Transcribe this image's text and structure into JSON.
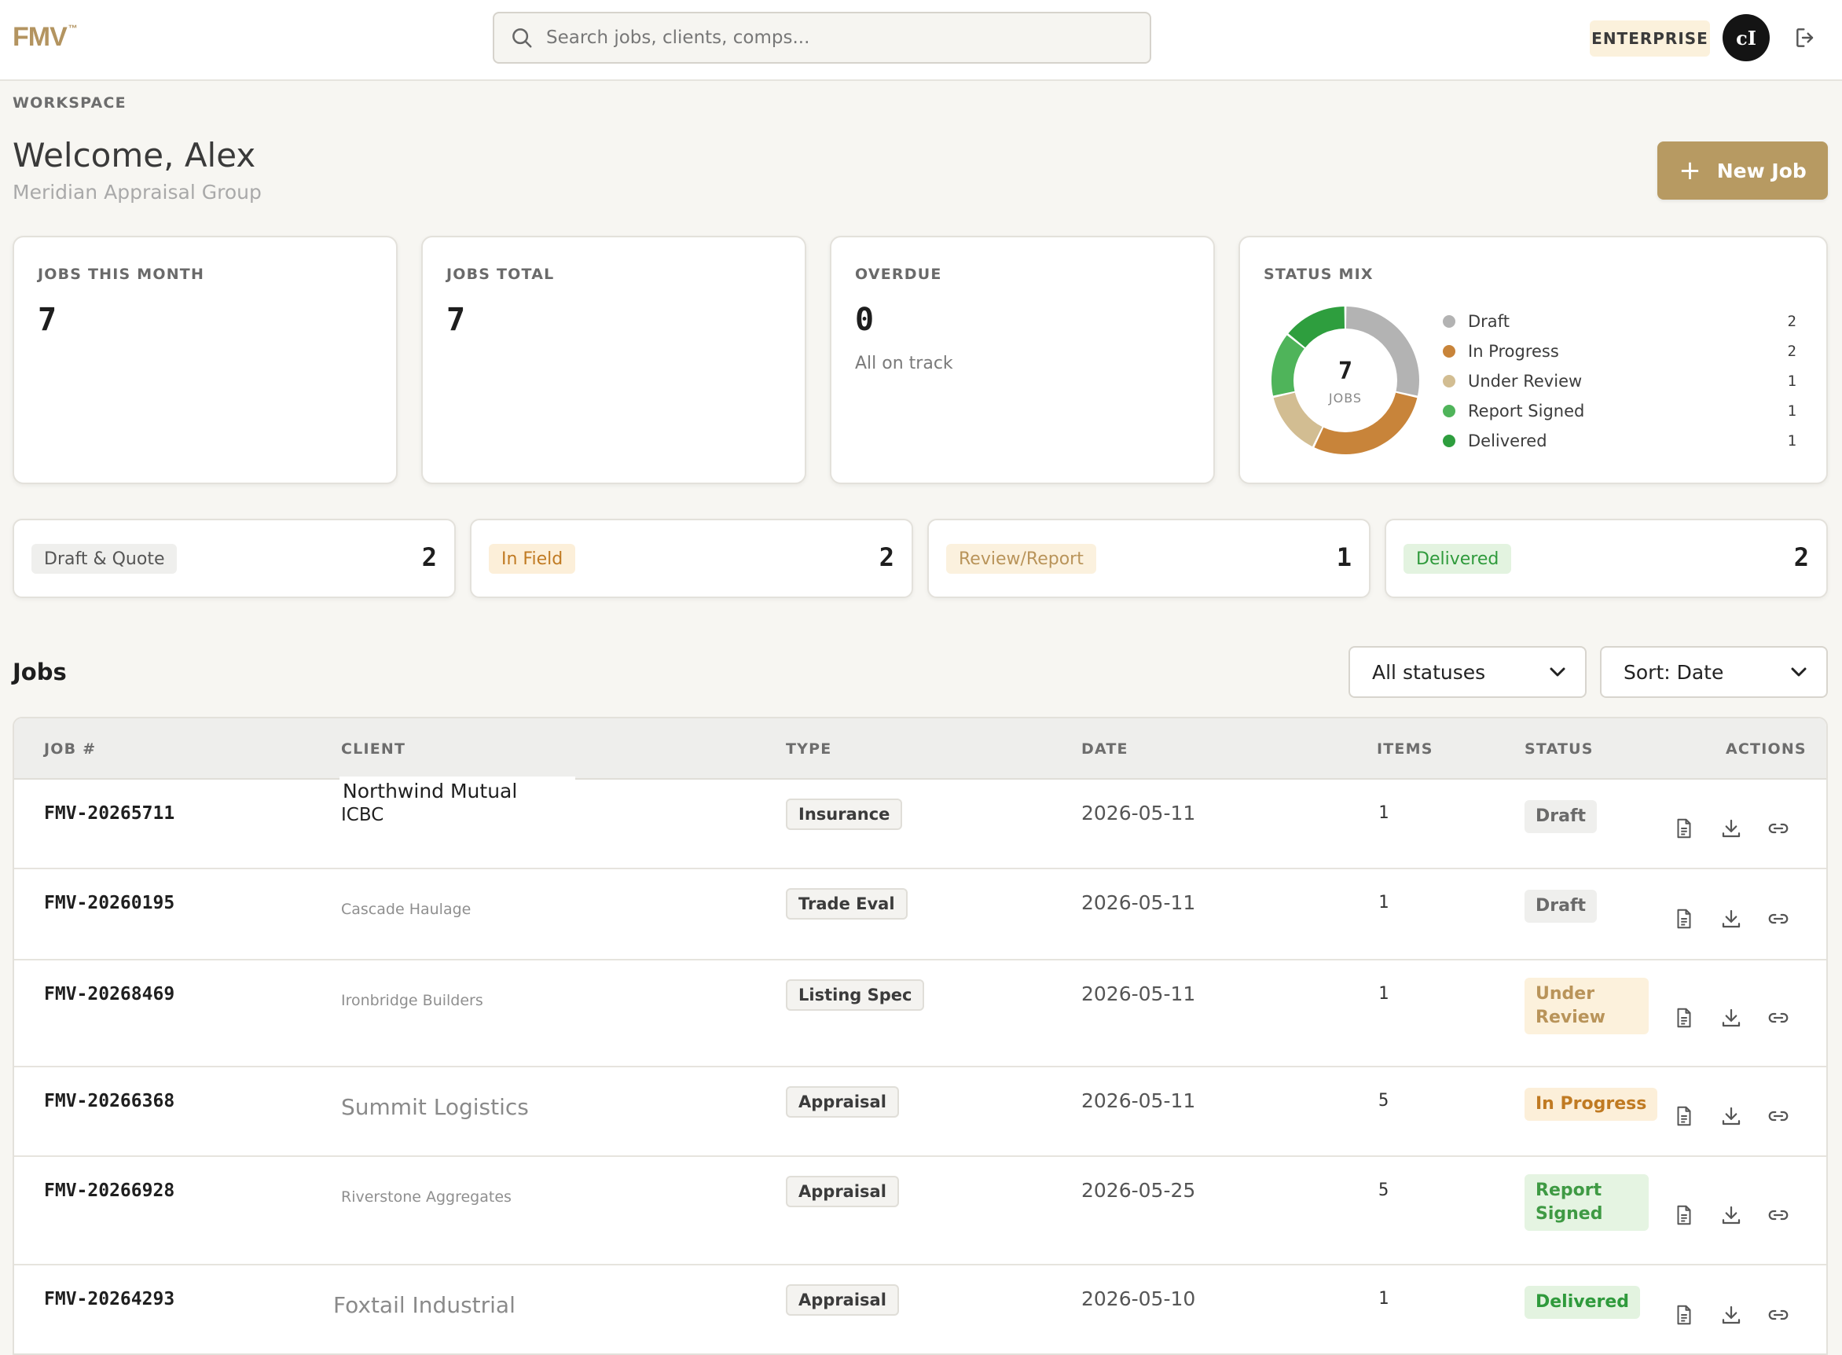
{
  "app": {
    "logo": "FMV",
    "logo_tm": "™",
    "search_placeholder": "Search jobs, clients, comps...",
    "plan": "ENTERPRISE",
    "avatar_initials": "cI"
  },
  "header": {
    "section_label": "WORKSPACE",
    "welcome": "Welcome, Alex",
    "org": "Meridian Appraisal Group",
    "new_job_label": "New Job"
  },
  "stats": {
    "jobs_this_month": {
      "label": "JOBS THIS MONTH",
      "value": "7"
    },
    "jobs_total": {
      "label": "JOBS TOTAL",
      "value": "7"
    },
    "overdue": {
      "label": "OVERDUE",
      "value": "0",
      "sub": "All on track"
    },
    "status_mix": {
      "label": "STATUS MIX",
      "center_value": "7",
      "center_label": "JOBS",
      "legend": [
        {
          "name": "Draft",
          "count": "2",
          "color": "#b3b3b3"
        },
        {
          "name": "In Progress",
          "count": "2",
          "color": "#c8843a"
        },
        {
          "name": "Under Review",
          "count": "1",
          "color": "#d2bd92"
        },
        {
          "name": "Report Signed",
          "count": "1",
          "color": "#4fb45a"
        },
        {
          "name": "Delivered",
          "count": "1",
          "color": "#2e9e3e"
        }
      ]
    }
  },
  "chart_data": {
    "type": "pie",
    "categories": [
      "Draft",
      "In Progress",
      "Under Review",
      "Report Signed",
      "Delivered"
    ],
    "values": [
      2,
      2,
      1,
      1,
      1
    ],
    "colors": [
      "#b3b3b3",
      "#c8843a",
      "#d2bd92",
      "#4fb45a",
      "#2e9e3e"
    ],
    "title": "STATUS MIX",
    "center_text": "7 JOBS",
    "legend": "right"
  },
  "stages": [
    {
      "label": "Draft & Quote",
      "count": "2",
      "bg": "#efefed",
      "fg": "#555555"
    },
    {
      "label": "In Field",
      "count": "2",
      "bg": "#fcefd9",
      "fg": "#c07a22"
    },
    {
      "label": "Review/Report",
      "count": "1",
      "bg": "#fbf1de",
      "fg": "#b9945a"
    },
    {
      "label": "Delivered",
      "count": "2",
      "bg": "#e3f3e0",
      "fg": "#2f9a3c"
    }
  ],
  "jobs": {
    "title": "Jobs",
    "status_filter": "All statuses",
    "sort": "Sort: Date",
    "columns": [
      "JOB #",
      "CLIENT",
      "TYPE",
      "DATE",
      "ITEMS",
      "STATUS",
      "ACTIONS"
    ],
    "rows": [
      {
        "job": "FMV-20265711",
        "client": "ICBC",
        "client_overlay": "Northwind Mutual",
        "type": "Insurance",
        "date": "2026-05-11",
        "items": "1",
        "status": "Draft",
        "status_class": "st-draft"
      },
      {
        "job": "FMV-20260195",
        "client": "Cascade Haulage",
        "type": "Trade Eval",
        "date": "2026-05-11",
        "items": "1",
        "status": "Draft",
        "status_class": "st-draft"
      },
      {
        "job": "FMV-20268469",
        "client": "Ironbridge Builders",
        "type": "Listing Spec",
        "date": "2026-05-11",
        "items": "1",
        "status": "Under Review",
        "status_class": "st-review"
      },
      {
        "job": "FMV-20266368",
        "client": "Summit Logistics",
        "type": "Appraisal",
        "date": "2026-05-11",
        "items": "5",
        "status": "In Progress",
        "status_class": "st-progress"
      },
      {
        "job": "FMV-20266928",
        "client": "Riverstone Aggregates",
        "type": "Appraisal",
        "date": "2026-05-25",
        "items": "5",
        "status": "Report Signed",
        "status_class": "st-signed"
      },
      {
        "job": "FMV-20264293",
        "client": "Foxtail Industrial",
        "type": "Appraisal",
        "date": "2026-05-10",
        "items": "1",
        "status": "Delivered",
        "status_class": "st-delivered"
      }
    ]
  },
  "icons": {
    "search": "search-icon",
    "logout": "logout-icon",
    "report": "document-icon",
    "download": "download-icon",
    "link": "link-icon",
    "chevron": "chevron-down-icon"
  }
}
